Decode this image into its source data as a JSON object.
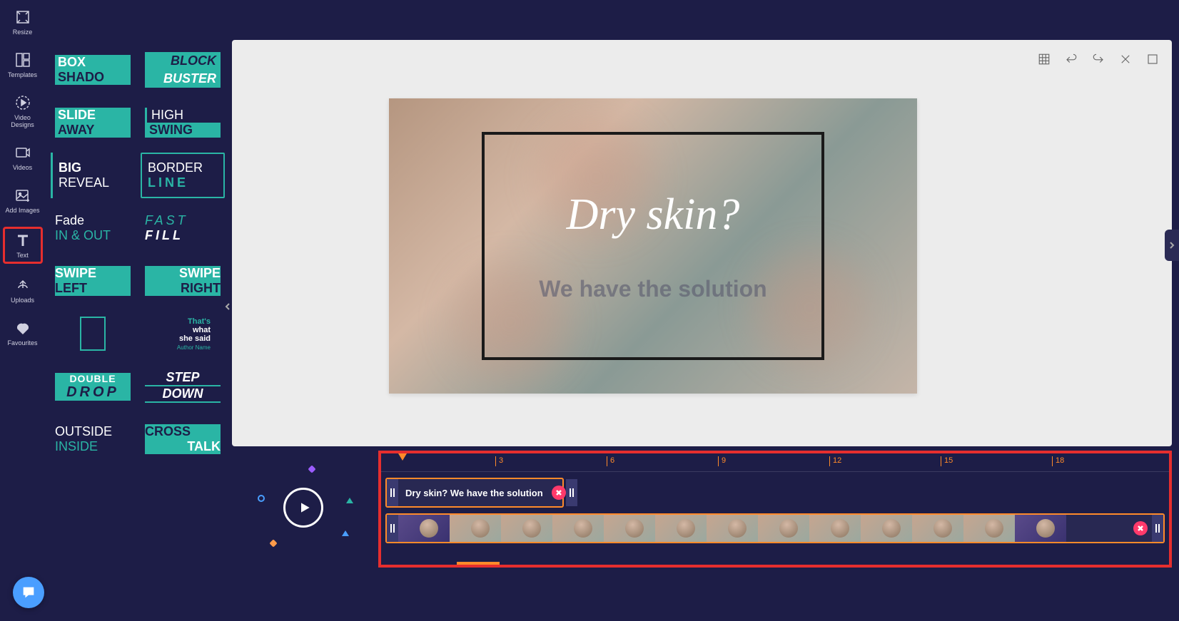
{
  "sidebar": {
    "items": [
      {
        "label": "Resize",
        "icon": "resize"
      },
      {
        "label": "Templates",
        "icon": "templates"
      },
      {
        "label": "Video Designs",
        "icon": "video-designs"
      },
      {
        "label": "Videos",
        "icon": "videos"
      },
      {
        "label": "Add Images",
        "icon": "add-images"
      },
      {
        "label": "Text",
        "icon": "text",
        "selected": true
      },
      {
        "label": "Uploads",
        "icon": "uploads"
      },
      {
        "label": "Favourites",
        "icon": "favourites"
      }
    ]
  },
  "text_styles": [
    {
      "line1": "BOX",
      "line2": "SHADO"
    },
    {
      "line1": "BLOCK",
      "line2": "BUSTER"
    },
    {
      "line1": "SLIDE",
      "line2": "AWAY"
    },
    {
      "line1": "HIGH",
      "line2": "SWING"
    },
    {
      "line1": "BIG",
      "line2": "REVEAL"
    },
    {
      "line1": "BORDER",
      "line2": "LINE"
    },
    {
      "line1": "Fade",
      "line2": "IN & OUT"
    },
    {
      "line1": "FAST",
      "line2": "FILL"
    },
    {
      "line1": "SWIPE",
      "line2": "LEFT"
    },
    {
      "line1": "SWIPE",
      "line2": "RIGHT"
    },
    {
      "line1": "",
      "line2": ""
    },
    {
      "q1": "That's",
      "q2": "what",
      "q3": "she said",
      "q4": "Author Name"
    },
    {
      "line1": "DOUBLE",
      "line2": "DROP"
    },
    {
      "line1": "STEP",
      "line2": "DOWN"
    },
    {
      "line1": "OUTSIDE",
      "line2": "INSIDE"
    },
    {
      "line1": "CROSS",
      "line2": "TALK"
    }
  ],
  "canvas": {
    "title": "Dry skin?",
    "subtitle": "We have the solution"
  },
  "timeline": {
    "ticks": [
      "3",
      "6",
      "9",
      "12",
      "15",
      "18"
    ],
    "text_track_label": "Dry skin? We have the solution"
  }
}
